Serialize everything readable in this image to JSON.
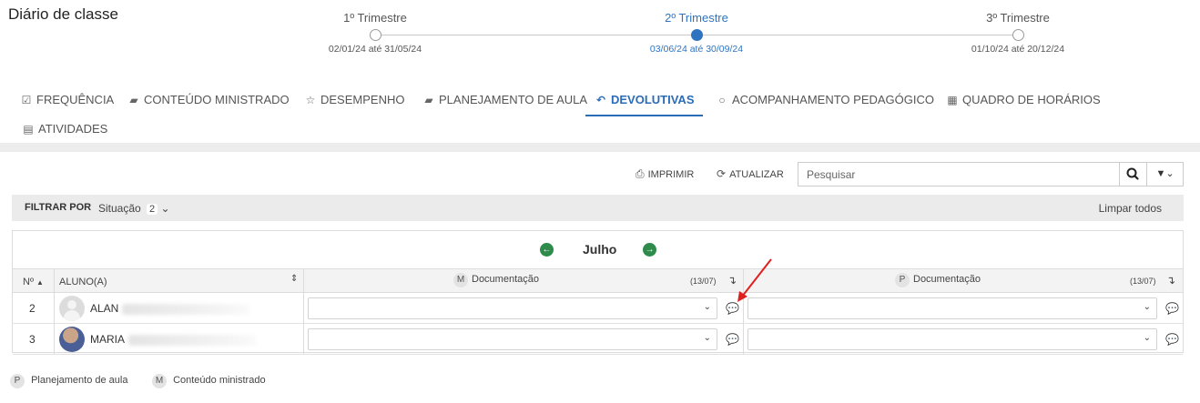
{
  "page": {
    "title": "Diário de classe"
  },
  "trimesters": [
    {
      "name": "1º Trimestre",
      "dates": "02/01/24 até 31/05/24",
      "active": false
    },
    {
      "name": "2º Trimestre",
      "dates": "03/06/24 até 30/09/24",
      "active": true
    },
    {
      "name": "3º Trimestre",
      "dates": "01/10/24 até 20/12/24",
      "active": false
    }
  ],
  "tabs": [
    {
      "label": "FREQUÊNCIA",
      "icon": "checkbox-icon"
    },
    {
      "label": "CONTEÚDO MINISTRADO",
      "icon": "book-icon"
    },
    {
      "label": "DESEMPENHO",
      "icon": "star-icon"
    },
    {
      "label": "PLANEJAMENTO DE AULA",
      "icon": "book-icon"
    },
    {
      "label": "DEVOLUTIVAS",
      "icon": "reply-icon",
      "active": true
    },
    {
      "label": "ACOMPANHAMENTO PEDAGÓGICO",
      "icon": "comment-icon"
    },
    {
      "label": "QUADRO DE HORÁRIOS",
      "icon": "calendar-icon"
    },
    {
      "label": "ATIVIDADES",
      "icon": "document-icon"
    }
  ],
  "toolbar": {
    "print_label": "IMPRIMIR",
    "refresh_label": "ATUALIZAR",
    "search_placeholder": "Pesquisar"
  },
  "filter": {
    "label": "FILTRAR POR",
    "situation_label": "Situação",
    "situation_count": "2",
    "clear_label": "Limpar todos"
  },
  "grid": {
    "month": "Julho",
    "col_num": "Nº",
    "col_student": "ALUNO(A)",
    "columns": [
      {
        "badge": "M",
        "title": "Documentação",
        "date": "(13/07)"
      },
      {
        "badge": "P",
        "title": "Documentação",
        "date": "(13/07)"
      }
    ],
    "rows": [
      {
        "num": "2",
        "name": "ALAN"
      },
      {
        "num": "3",
        "name": "MARIA"
      }
    ]
  },
  "legend": [
    {
      "badge": "P",
      "label": "Planejamento de aula"
    },
    {
      "badge": "M",
      "label": "Conteúdo ministrado"
    }
  ],
  "colors": {
    "accent": "#2f74c0",
    "nav_green": "#2e8b4b",
    "annotation_red": "#e0201f"
  }
}
